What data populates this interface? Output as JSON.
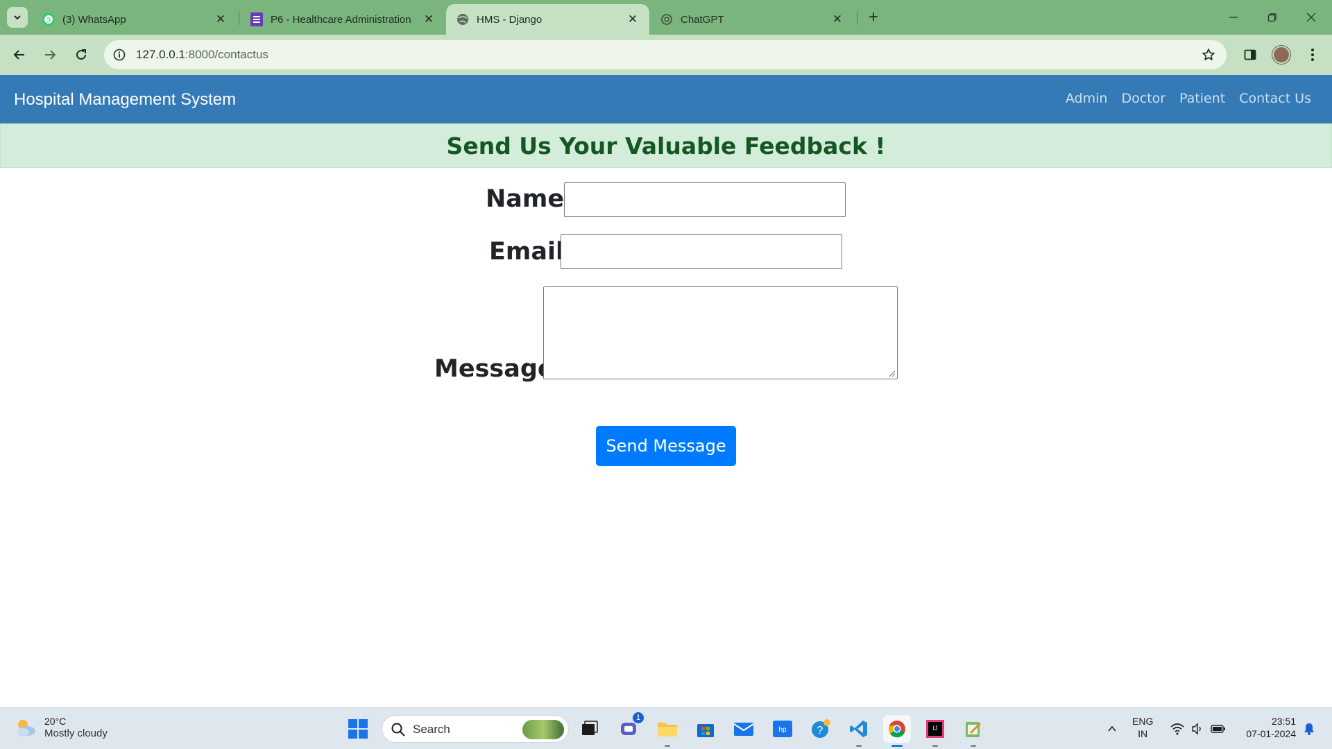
{
  "browser": {
    "tabs": [
      {
        "title": "(3) WhatsApp",
        "favicon": "whatsapp-icon"
      },
      {
        "title": "P6 - Healthcare Administration",
        "favicon": "forms-icon"
      },
      {
        "title": "HMS - Django",
        "favicon": "globe-icon",
        "active": true
      },
      {
        "title": "ChatGPT",
        "favicon": "chatgpt-icon"
      }
    ],
    "url_host": "127.0.0.1",
    "url_rest": ":8000/contactus",
    "accent": "#7bb57e"
  },
  "app": {
    "brand": "Hospital Management System",
    "nav": [
      "Admin",
      "Doctor",
      "Patient",
      "Contact Us"
    ],
    "navbar_color": "#337ab7"
  },
  "feedback": {
    "heading": "Send Us Your Valuable Feedback !",
    "name_label": "Name:",
    "email_label": "Email:",
    "message_label": "Message:",
    "name_value": "",
    "email_value": "",
    "message_value": "",
    "submit_label": "Send Message",
    "button_color": "#007bff"
  },
  "taskbar": {
    "temperature": "20°C",
    "condition": "Mostly cloudy",
    "search_placeholder": "Search",
    "teams_badge": "1",
    "language": "ENG",
    "region": "IN",
    "time": "23:51",
    "date": "07-01-2024"
  }
}
